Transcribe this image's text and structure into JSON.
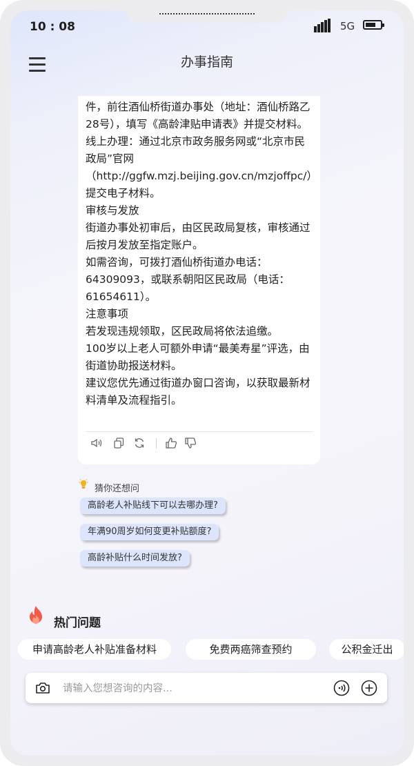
{
  "status_bar": {
    "time": "10 : 08",
    "network": "5G"
  },
  "header": {
    "title": "办事指南"
  },
  "chat": {
    "lines": [
      "件，前往酒仙桥街道办事处（地址：酒仙桥路乙28号），填写《高龄津贴申请表》并提交材料。",
      "线上办理：通过北京市政务服务网或“北京市民政局”官网（http://ggfw.mzj.beijing.gov.cn/mzjoffpc/）提交电子材料。",
      "审核与发放",
      "街道办事处初审后，由区民政局复核，审核通过后按月发放至指定账户。",
      "如需咨询，可拨打酒仙桥街道办电话：64309093，或联系朝阳区民政局（电话：61654611）。",
      "注意事项",
      "若发现违规领取，区民政局将依法追缴。",
      "100岁以上老人可额外申请“最美寿星”评选，由街道协助报送材料。",
      "建议您优先通过街道办窗口咨询，以获取最新材料清单及流程指引。"
    ]
  },
  "suggestions": {
    "heading": "猜你还想问",
    "items": [
      "高龄老人补贴线下可以去哪办理?",
      "年满90周岁如何变更补贴额度?",
      "高龄补贴什么时间发放?"
    ]
  },
  "hot": {
    "title": "热门问题",
    "items": [
      "申请高龄老人补贴准备材料",
      "免费两癌筛查预约",
      "公积金迁出"
    ]
  },
  "input": {
    "placeholder": "请输入您想咨询的内容..."
  }
}
